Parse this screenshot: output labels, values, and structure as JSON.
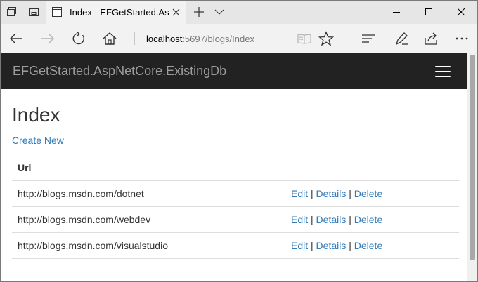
{
  "browser": {
    "tab": {
      "title": "Index - EFGetStarted.As"
    },
    "address": {
      "host": "localhost",
      "rest": ":5697/blogs/Index"
    }
  },
  "site": {
    "brand": "EFGetStarted.AspNetCore.ExistingDb",
    "page_title": "Index",
    "create_link": "Create New",
    "table": {
      "header": "Url",
      "rows": [
        {
          "url": "http://blogs.msdn.com/dotnet",
          "edit": "Edit",
          "details": "Details",
          "delete": "Delete",
          "sep": "|"
        },
        {
          "url": "http://blogs.msdn.com/webdev",
          "edit": "Edit",
          "details": "Details",
          "delete": "Delete",
          "sep": "|"
        },
        {
          "url": "http://blogs.msdn.com/visualstudio",
          "edit": "Edit",
          "details": "Details",
          "delete": "Delete",
          "sep": "|"
        }
      ]
    }
  },
  "colors": {
    "navbar_bg": "#222222",
    "brand_text": "#9d9d9d",
    "link": "#337ab7",
    "text": "#333333"
  },
  "icons": {
    "tabstrip": [
      "set-aside-tabs-icon",
      "tab-previews-icon"
    ],
    "tab": [
      "page-favicon",
      "close-icon"
    ],
    "tab_actions": [
      "new-tab-plus-icon",
      "tab-list-chevron-icon"
    ],
    "window": [
      "minimize-icon",
      "maximize-icon",
      "close-window-icon"
    ],
    "nav": [
      "back-arrow-icon",
      "forward-arrow-icon",
      "refresh-icon",
      "home-icon"
    ],
    "toolbar": [
      "reading-view-icon",
      "favorites-star-icon",
      "hub-icon",
      "web-note-icon",
      "share-icon",
      "more-icon"
    ],
    "site": [
      "hamburger-menu-icon"
    ]
  }
}
